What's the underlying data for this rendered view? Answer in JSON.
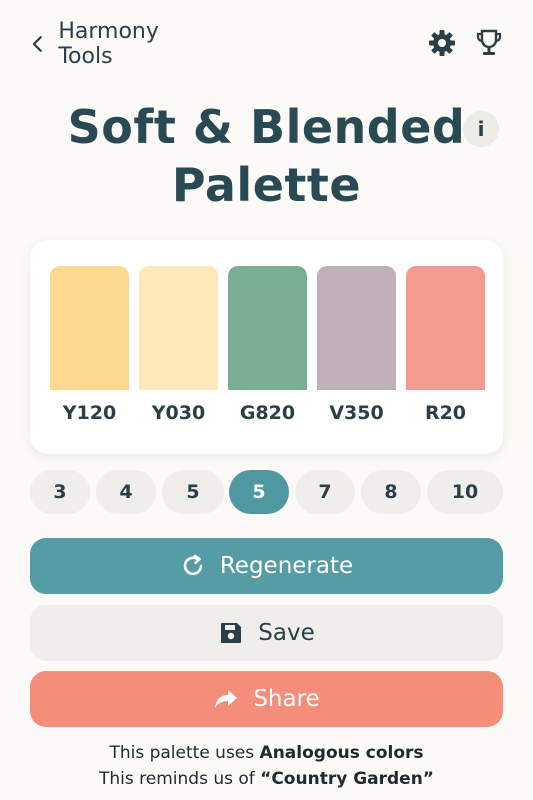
{
  "header": {
    "back_label": "Harmony Tools"
  },
  "title": {
    "line1": "Soft & Blended",
    "line2": "Palette",
    "info_symbol": "i"
  },
  "swatches": [
    {
      "code": "Y120",
      "color": "#fdd88f"
    },
    {
      "code": "Y030",
      "color": "#fde8b9"
    },
    {
      "code": "G820",
      "color": "#79ae94"
    },
    {
      "code": "V350",
      "color": "#bfb0b9"
    },
    {
      "code": "R20",
      "color": "#f29b8e"
    }
  ],
  "counts": {
    "options": [
      "3",
      "4",
      "5",
      "5",
      "7",
      "8",
      "10"
    ],
    "selected_index": 3
  },
  "actions": {
    "regenerate": "Regenerate",
    "save": "Save",
    "share": "Share"
  },
  "footer": {
    "line1_prefix": "This palette uses ",
    "line1_bold": "Analogous colors",
    "line2_prefix": "This reminds us of ",
    "line2_bold": "“Country Garden”"
  },
  "colors": {
    "accent": "#559ca4",
    "share": "#f48d7a",
    "text": "#2a3f47"
  }
}
